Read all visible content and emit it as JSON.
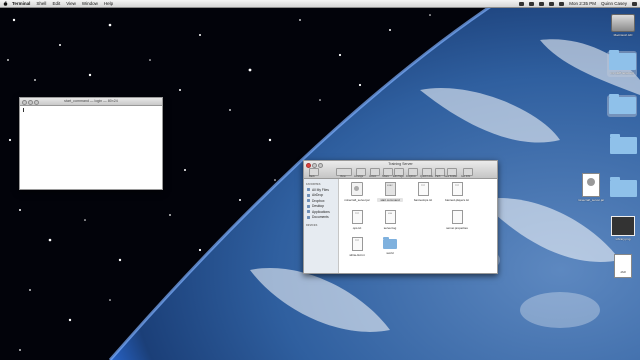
{
  "menubar": {
    "app_name": "Terminal",
    "items": [
      "Shell",
      "Edit",
      "View",
      "Window",
      "Help"
    ],
    "clock": "Mon 2:35 PM",
    "user": "Quinn Casey"
  },
  "terminal": {
    "title": "start_command — login — 80×24"
  },
  "finder": {
    "title": "Training Server",
    "toolbar": [
      "Back",
      "View",
      "Arrange",
      "Action",
      "Share",
      "Edit Tags",
      "Dropbox",
      "Quick Look",
      "Path",
      "New Folder",
      "Get Info"
    ],
    "sidebar_favorites_heading": "FAVORITES",
    "sidebar_items": [
      "All My Files",
      "AirDrop",
      "Dropbox",
      "Desktop",
      "Applications",
      "Documents"
    ],
    "sidebar_devices_heading": "DEVICES",
    "files": [
      {
        "name": "minecraft_server.jar",
        "ext": "JAR",
        "kind": "jar"
      },
      {
        "name": "start.command",
        "ext": "EXEC",
        "kind": "doc",
        "selected": true
      },
      {
        "name": "banned-ips.txt",
        "ext": "TXT",
        "kind": "doc"
      },
      {
        "name": "banned-players.txt",
        "ext": "TXT",
        "kind": "doc"
      },
      {
        "name": "ops.txt",
        "ext": "TXT",
        "kind": "doc"
      },
      {
        "name": "server.log",
        "ext": "LOG",
        "kind": "doc"
      },
      {
        "name": "server.properties",
        "ext": "",
        "kind": "doc"
      },
      {
        "name": "white-list.txt",
        "ext": "TXT",
        "kind": "doc"
      },
      {
        "name": "world",
        "ext": "",
        "kind": "folder"
      }
    ]
  },
  "desktop": {
    "icons": [
      {
        "name": "Macintosh HD",
        "kind": "hd"
      },
      {
        "name": "mc stuff renamed",
        "kind": "folder"
      },
      {
        "name": "",
        "kind": "folder"
      },
      {
        "name": "",
        "kind": "folder"
      },
      {
        "name": "minecraft_server.jar",
        "kind": "jar"
      },
      {
        "name": "",
        "kind": "folder"
      },
      {
        "name": "Library.png",
        "kind": "image"
      },
      {
        "name": "JAR",
        "kind": "doc"
      }
    ]
  }
}
